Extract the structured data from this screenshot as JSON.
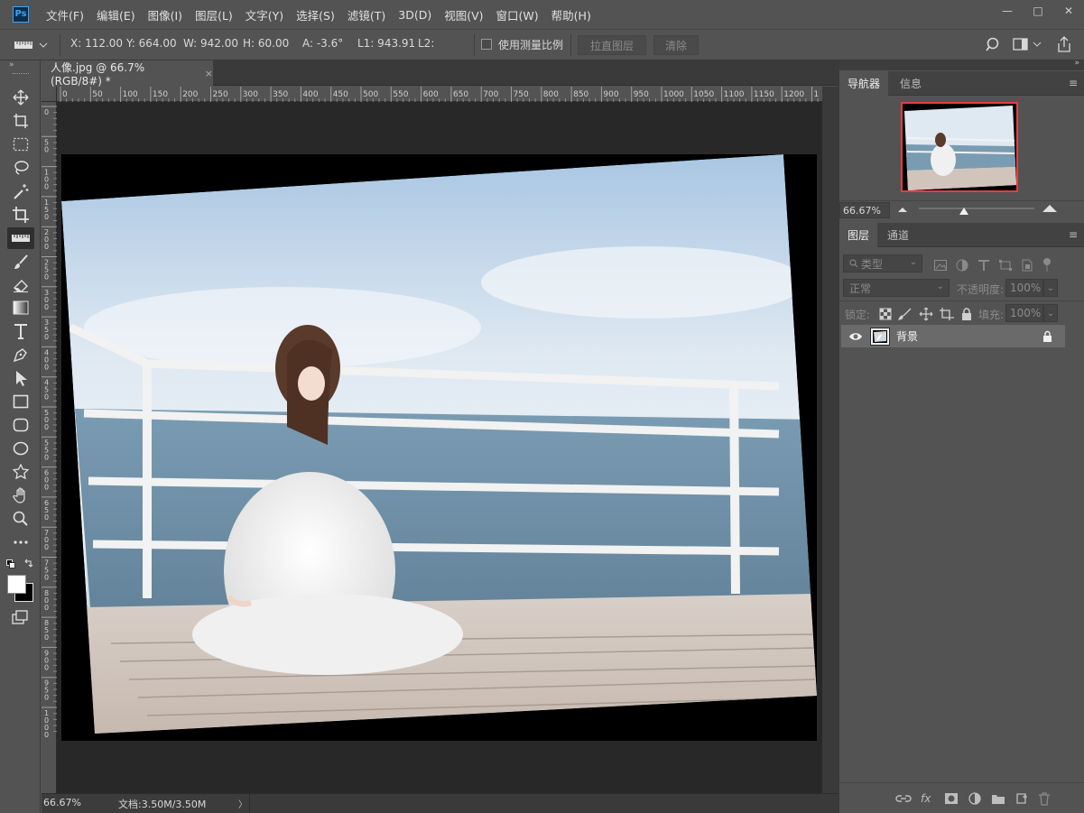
{
  "menubar": {
    "logo": "Ps",
    "items": [
      "文件(F)",
      "编辑(E)",
      "图像(I)",
      "图层(L)",
      "文字(Y)",
      "选择(S)",
      "滤镜(T)",
      "3D(D)",
      "视图(V)",
      "窗口(W)",
      "帮助(H)"
    ]
  },
  "window_controls": {
    "minimize": "—",
    "restore": "□",
    "close": "✕"
  },
  "options": {
    "x": "X: 112.00",
    "y": "Y: 664.00",
    "w": "W: 942.00",
    "h": "H: 60.00",
    "a": "A: -3.6°",
    "l1": "L1: 943.91",
    "l2": "L2:",
    "scale_checkbox_label": "使用测量比例",
    "straighten_button": "拉直图层",
    "clear_button": "清除"
  },
  "document": {
    "tab_title": "人像.jpg @ 66.7%(RGB/8#) *",
    "tab_close": "×",
    "zoom": "66.67%",
    "doc_size": "文档:3.50M/3.50M",
    "status_arrow": "〉"
  },
  "ruler_h_labels": [
    "0",
    "50",
    "100",
    "150",
    "200",
    "250",
    "300",
    "350",
    "400",
    "450",
    "500",
    "550",
    "600",
    "650",
    "700",
    "750",
    "800",
    "850",
    "900",
    "950",
    "1000",
    "1050",
    "1100",
    "1150",
    "1200",
    "1"
  ],
  "ruler_v_labels": [
    "0",
    "50",
    "100",
    "150",
    "200",
    "250",
    "300",
    "350",
    "400",
    "450",
    "500",
    "550",
    "600",
    "650",
    "700",
    "750",
    "800",
    "850",
    "900",
    "950",
    "1000"
  ],
  "navigator": {
    "tab_navigator": "导航器",
    "tab_info": "信息",
    "zoom": "66.67%",
    "zoom_slider_value": 0.39
  },
  "layers": {
    "tab_layers": "图层",
    "tab_channels": "通道",
    "filter_placeholder": "类型",
    "blend_mode": "正常",
    "opacity_label": "不透明度:",
    "opacity_value": "100%",
    "lock_label": "锁定:",
    "fill_label": "填充:",
    "fill_value": "100%",
    "layer_name": "背景"
  }
}
